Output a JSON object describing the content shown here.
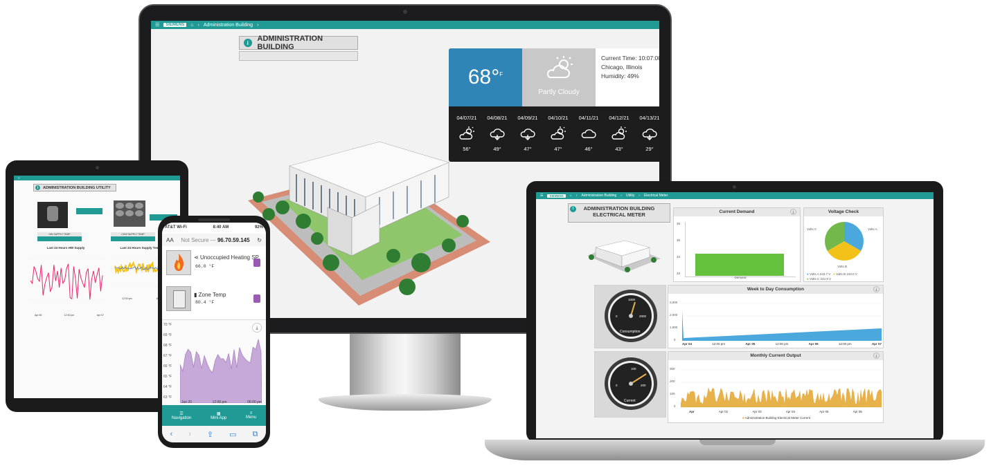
{
  "monitor": {
    "topbar": {
      "brand": "SIEMENS",
      "breadcrumb": "Administration Building"
    },
    "title": "ADMINISTRATION BUILDING",
    "weather": {
      "temp": "68°",
      "temp_unit": "F",
      "condition": "Partly Cloudy",
      "current_time": "Current Time: 10:07:00",
      "location": "Chicago, Illinois",
      "humidity": "Humidity: 49%",
      "forecast": [
        {
          "date": "04/07/21",
          "icon": "partly-cloudy-icon",
          "temp": "56°"
        },
        {
          "date": "04/08/21",
          "icon": "rain-cloud-icon",
          "temp": "49°"
        },
        {
          "date": "04/09/21",
          "icon": "rain-cloud-icon",
          "temp": "47°"
        },
        {
          "date": "04/10/21",
          "icon": "partly-cloudy-icon",
          "temp": "47°"
        },
        {
          "date": "04/11/21",
          "icon": "cloud-icon",
          "temp": "46°"
        },
        {
          "date": "04/12/21",
          "icon": "partly-cloudy-icon",
          "temp": "43°"
        },
        {
          "date": "04/13/21",
          "icon": "rain-cloud-icon",
          "temp": "29°"
        }
      ]
    }
  },
  "tablet": {
    "title": "ADMINISTRATION BUILDING UTILITY",
    "supply_left": "HW SUPPLY TEMP",
    "supply_right": "CHW SUPPLY TEMP",
    "chart_left_title": "Last 24 Hours HW Supply",
    "chart_right_title": "Last 24 Hours Supply Temp vs 7",
    "x_left": [
      "Apr 06",
      "12:00 pm",
      "Apr 07"
    ],
    "x_right": [
      "12:00 pm",
      "Apr 07"
    ]
  },
  "phone": {
    "status": {
      "carrier": "AT&T Wi-Fi",
      "time": "8:40 AM",
      "battery": "92%"
    },
    "address": {
      "size": "AA",
      "prefix": "Not Secure — ",
      "url": "96.70.59.145"
    },
    "points": [
      {
        "name": "Unoccupied Heating SP",
        "value": "66.0 °F"
      },
      {
        "name": "Zone Temp",
        "value": "80.4 °F"
      }
    ],
    "y_labels": [
      "70 °F",
      "69 °F",
      "68 °F",
      "67 °F",
      "66 °F",
      "65 °F",
      "64 °F",
      "63 °F"
    ],
    "x_labels": [
      "Jun 20",
      "12:00 pm",
      "06:00 pm"
    ],
    "nav": [
      "Navigation",
      "Mini App",
      "Menu"
    ]
  },
  "laptop": {
    "topbar": {
      "brand": "SIEMENS",
      "crumbs": [
        "Administration Building",
        "Utility",
        "Electrical Meter"
      ]
    },
    "title_line1": "ADMINISTRATION BUILDING",
    "title_line2": "ELECTRICAL METER",
    "current_demand": {
      "title": "Current Demand",
      "y": [
        "36",
        "35",
        "34",
        "33"
      ],
      "bar_label": "Demand"
    },
    "voltage": {
      "title": "Voltage Check",
      "labels": [
        "Volts C",
        "Volts A",
        "Volts B"
      ],
      "legend": [
        "Volts A 243.7 V",
        "Volts B 243.0 V",
        "Volts C 242.9 V"
      ]
    },
    "gauge1": {
      "label": "Consumption",
      "ticks": [
        "0",
        "1000",
        "2000"
      ]
    },
    "gauge2": {
      "label": "Current",
      "ticks": [
        "0",
        "100",
        "200"
      ]
    },
    "week": {
      "title": "Week to Day Consumption",
      "y": [
        "3,000",
        "2,000",
        "1,000",
        "0"
      ],
      "x": [
        "Apr 04",
        "12:00 pm",
        "Apr 05",
        "12:00 pm",
        "Apr 06",
        "12:00 pm",
        "Apr 07"
      ]
    },
    "monthly": {
      "title": "Monthly Current Output",
      "y": [
        "300",
        "200",
        "100",
        "0"
      ],
      "x": [
        "Apr",
        "Apr 02",
        "Apr 03",
        "Apr 04",
        "Apr 05",
        "Apr 06"
      ],
      "legend": "Administration Building Electrical Meter Current"
    }
  },
  "colors": {
    "teal": "#1f9a94",
    "weather_blue": "#2f86b6",
    "demand_green": "#63c13c",
    "chart_blue": "#4aa8dc",
    "monthly_gold": "#e8b24a",
    "phone_purple": "#c6a8d9"
  }
}
